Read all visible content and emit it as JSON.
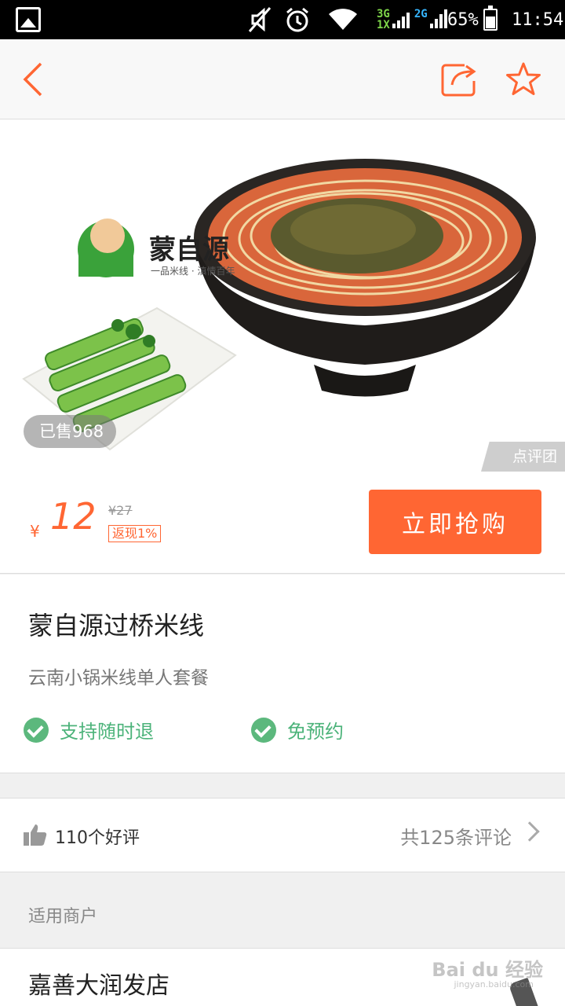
{
  "status_bar": {
    "network_top": "3G",
    "network_bottom": "1X",
    "network_2g": "2G",
    "battery": "65%",
    "time": "11:54",
    "icons": [
      "gallery-icon",
      "mute-icon",
      "alarm-icon",
      "wifi-icon",
      "signal-icon",
      "battery-icon"
    ]
  },
  "nav": {
    "icons": [
      "back-icon",
      "share-icon",
      "star-icon"
    ],
    "accent": "#ff6633"
  },
  "hero": {
    "brand_name": "蒙自源",
    "brand_slogan": "一品米线 · 滇情百年",
    "sold": "已售968",
    "watermark": "点评团"
  },
  "price": {
    "currency": "¥",
    "amount": "12",
    "original": "¥27",
    "rebate": "返现1%",
    "buy_label": "立即抢购"
  },
  "product": {
    "title": "蒙自源过桥米线",
    "subtitle": "云南小锅米线单人套餐",
    "features": [
      "支持随时退",
      "免预约"
    ],
    "feature_color": "#4cb37a"
  },
  "reviews": {
    "good": "110个好评",
    "total": "共125条评论"
  },
  "merchant_section": {
    "label": "适用商户",
    "name": "嘉善大润发店"
  },
  "watermark_bottom": {
    "logo": "Bai du 经验",
    "url": "jingyan.baidu.com"
  }
}
